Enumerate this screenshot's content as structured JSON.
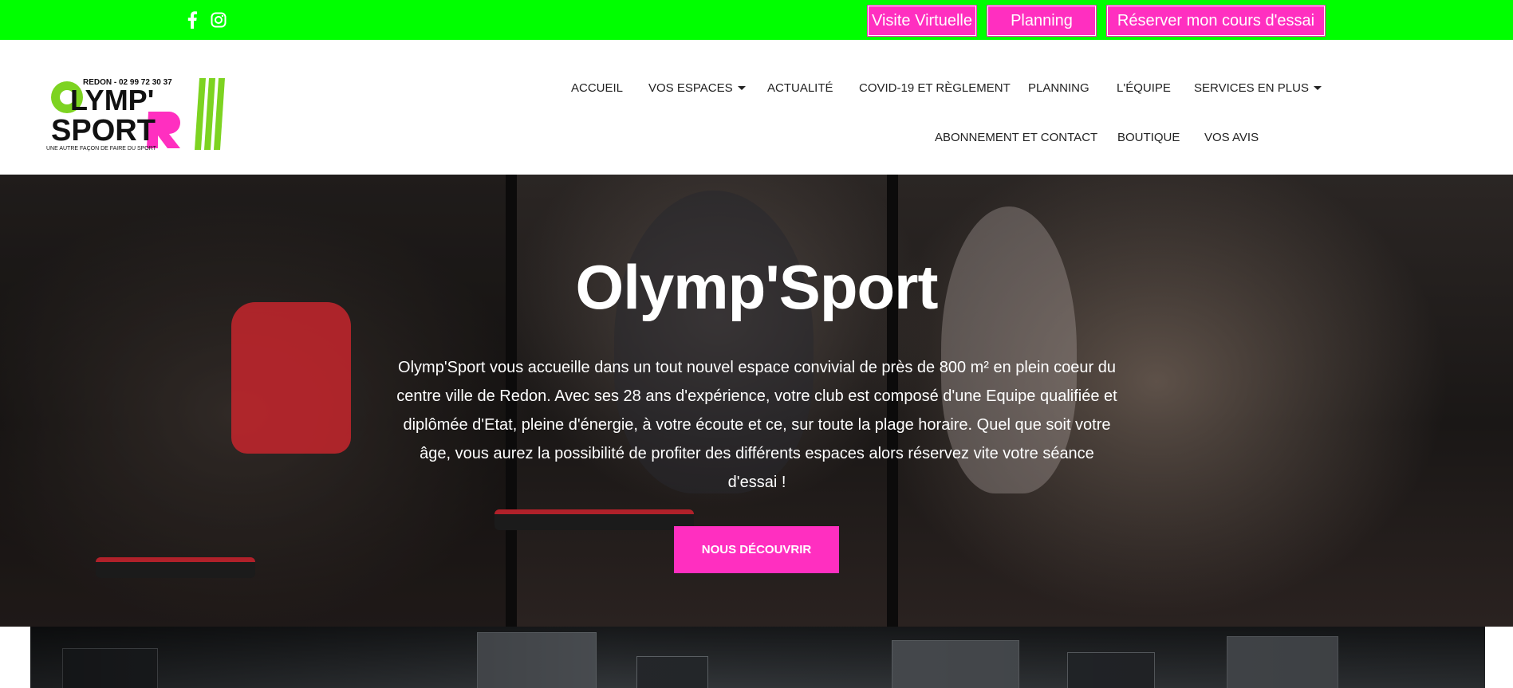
{
  "topbar": {
    "bg_color": "#00ff00",
    "social": [
      {
        "icon": "facebook-icon"
      },
      {
        "icon": "instagram-icon"
      }
    ],
    "buttons": [
      {
        "label": "Visite Virtuelle"
      },
      {
        "label": "Planning"
      },
      {
        "label": "Réserver mon cours d'essai"
      }
    ],
    "button_color": "#ff2fc0"
  },
  "header": {
    "logo": {
      "phone_line": "REDON - 02 99 72 30 37",
      "word1": "OLYMP'",
      "word2": "SPORT",
      "tagline": "UNE AUTRE FAÇON DE FAIRE DU SPORT",
      "colors": {
        "green": "#7dd321",
        "pink": "#ff2fc0",
        "dark": "#111111"
      }
    },
    "nav": [
      {
        "label": "ACCUEIL",
        "dropdown": false
      },
      {
        "label": "VOS ESPACES",
        "dropdown": true
      },
      {
        "label": "ACTUALITÉ",
        "dropdown": false
      },
      {
        "label": "COVID-19 ET RÈGLEMENT",
        "dropdown": false
      },
      {
        "label": "PLANNING",
        "dropdown": false
      },
      {
        "label": "L'ÉQUIPE",
        "dropdown": false
      },
      {
        "label": "SERVICES EN PLUS",
        "dropdown": true
      },
      {
        "label": "ABONNEMENT ET CONTACT",
        "dropdown": false
      },
      {
        "label": "BOUTIQUE",
        "dropdown": false
      },
      {
        "label": "VOS AVIS",
        "dropdown": false
      }
    ]
  },
  "hero": {
    "title": "Olymp'Sport",
    "text": "Olymp'Sport vous accueille dans un tout nouvel espace convivial de près de 800 m² en plein coeur du centre ville de Redon. Avec ses 28 ans d'expérience, votre club est composé d'une Equipe qualifiée et diplômée d'Etat, pleine d'énergie, à votre écoute et ce, sur toute la plage horaire. Quel que soit votre âge, vous aurez la possibilité de profiter des différents espaces alors réservez vite votre séance d'essai !",
    "cta": "NOUS DÉCOUVRIR",
    "cta_color": "#ff2fc0"
  }
}
